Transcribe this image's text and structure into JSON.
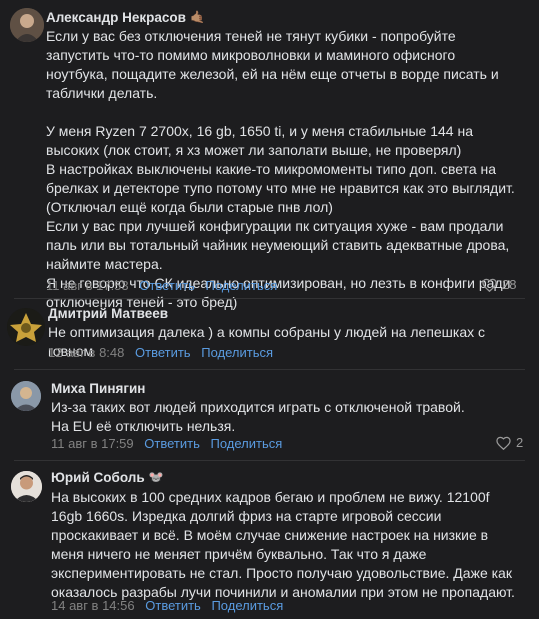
{
  "comments": [
    {
      "author": "Александр Некрасов",
      "badge": "🤙🏽",
      "text": "Если у вас без отключения теней не тянут кубики - попробуйте запустить что-то помимо микроволновки и маминого офисного ноутбука, пощадите железой, ей на нём еще отчеты в ворде писать и таблички делать.\n\nУ меня Ryzen 7 2700x, 16 gb, 1650 ti, и у меня стабильные 144 на высоких (лок стоит, я хз может ли заполати выше, не проверял)\nВ настройках выключены какие-то микромоменты типо доп. света на брелках и детекторе тупо потому что мне не нравится как это выглядит. (Отключал ещё когда были старые пнв лол)\nЕсли у вас при лучшей конфигурации пк ситуация хуже - вам продали паль или вы тотальный чайник неумеющий ставить адекватные дрова, наймите мастера.\nЯ не говорю что СК идеально оптимизирован, но лезть в конфиги ради отключения теней - это бред)",
      "date": "11 авг в 17:53",
      "reply": "Ответить",
      "share": "Поделиться",
      "likes": "28"
    },
    {
      "author": "Дмитрий Матвеев",
      "badge": "",
      "text": "Не оптимизация далека ) а компы собраны у людей на лепешках с говном",
      "date": "12 авг в 8:48",
      "reply": "Ответить",
      "share": "Поделиться",
      "likes": ""
    },
    {
      "author": "Миха Пинягин",
      "badge": "",
      "text": "Из-за таких вот людей приходится играть с отключеной травой.\nНа EU её отключить нельзя.",
      "date": "11 авг в 17:59",
      "reply": "Ответить",
      "share": "Поделиться",
      "likes": "2"
    },
    {
      "author": "Юрий Соболь",
      "badge": "🐭",
      "text": "На высоких в 100 средних кадров бегаю и проблем не вижу. 12100f 16gb 1660s. Изредка долгий фриз на старте игровой сессии проскакивает и всё. В моём случае снижение настроек на низкие в меня ничего не меняет причём буквально. Так что я даже экспериментировать не стал. Просто получаю удовольствие. Даже как оказалось разрабы лучи починили и аномалии при этом не пропадают.",
      "date": "14 авг в 14:56",
      "reply": "Ответить",
      "share": "Поделиться",
      "likes": ""
    }
  ],
  "colors": {
    "bg": "#1d1d1f",
    "text": "#e1e3e6",
    "meta": "#828282",
    "link": "#5a9be0"
  },
  "icons": {
    "like": "heart-icon"
  }
}
